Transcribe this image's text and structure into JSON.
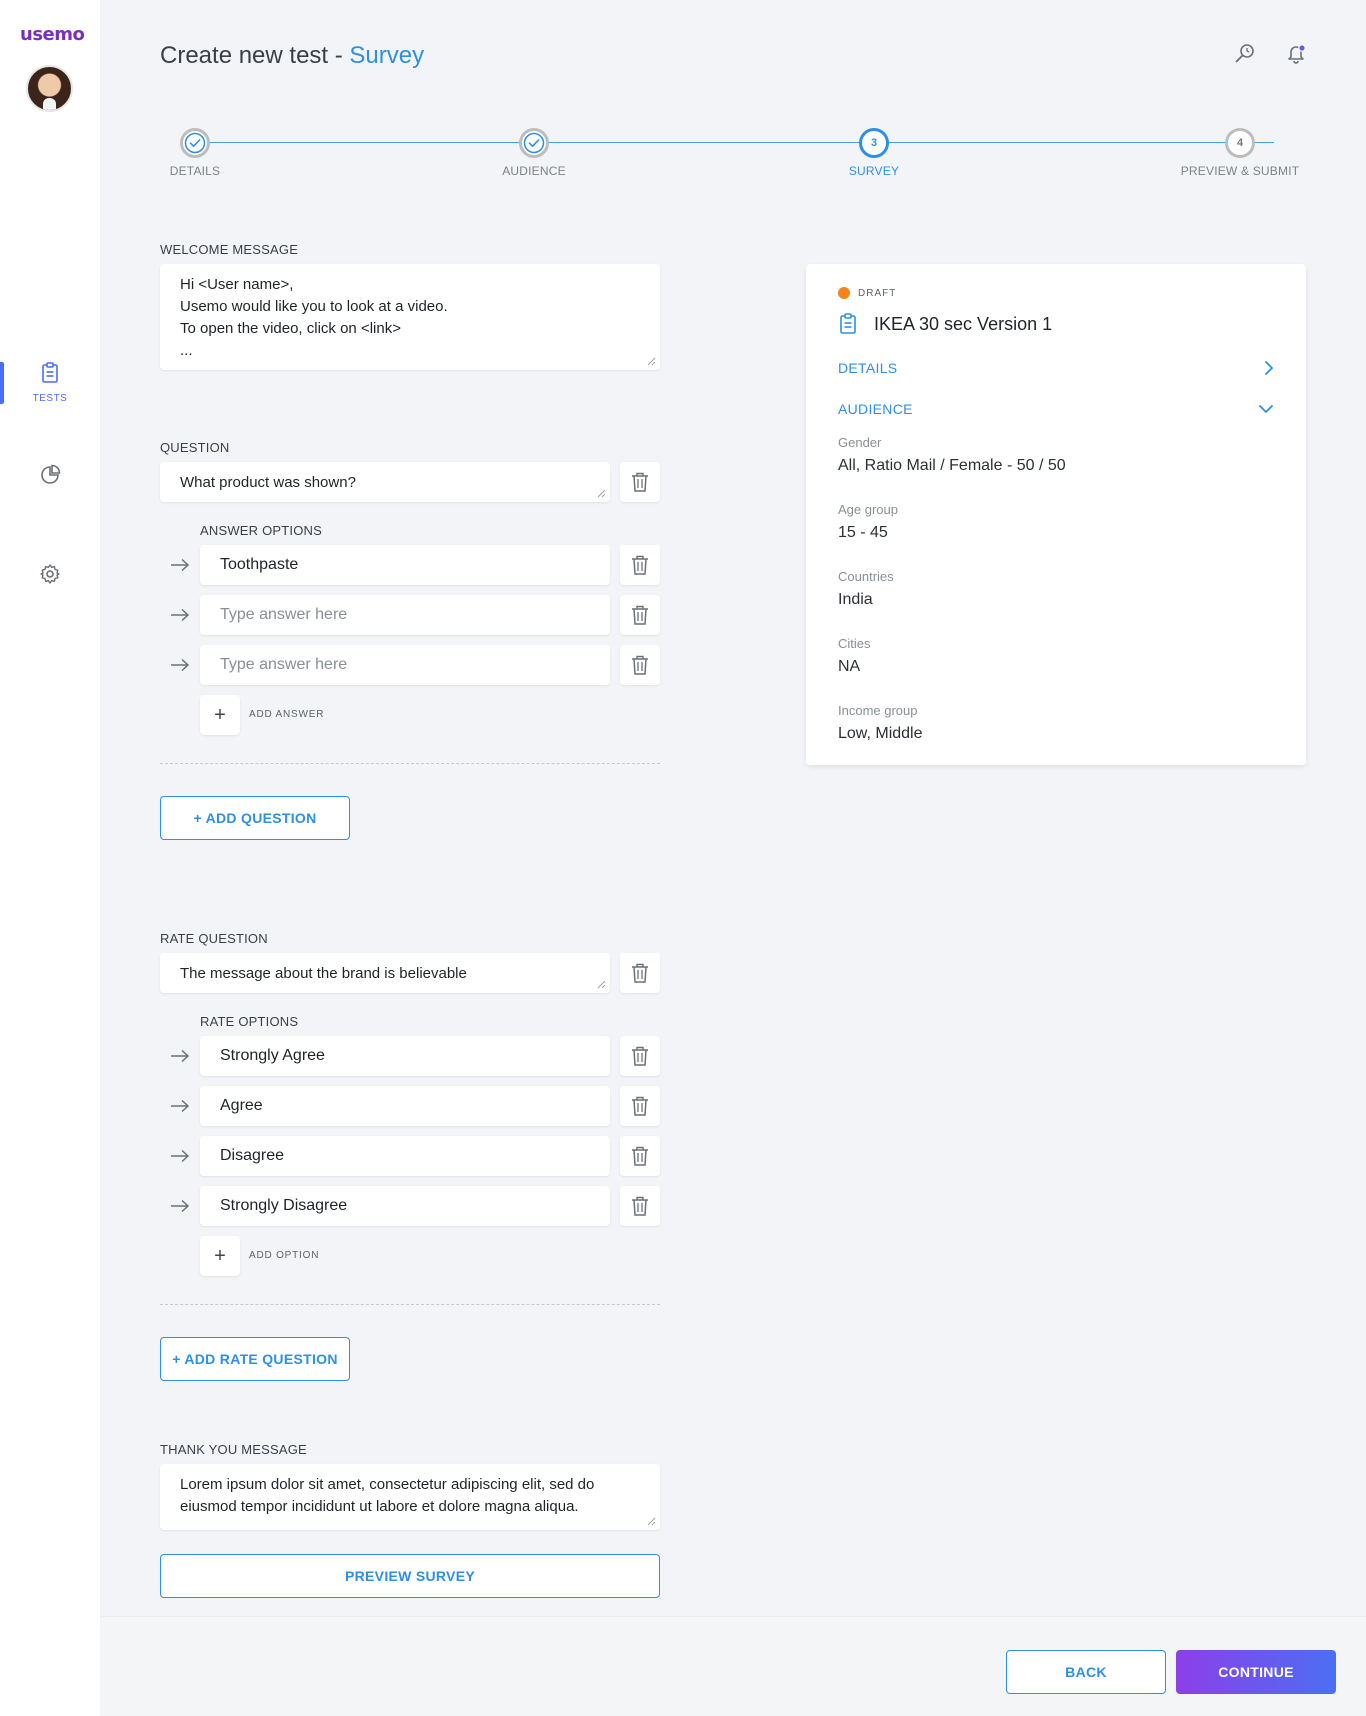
{
  "app": {
    "logo": "usemo"
  },
  "sidebar": {
    "items": [
      {
        "label": "TESTS",
        "icon": "clipboard-icon",
        "active": true
      },
      {
        "label": "",
        "icon": "pie-chart-icon"
      },
      {
        "label": "",
        "icon": "gear-icon"
      }
    ]
  },
  "header": {
    "title_prefix": "Create new test - ",
    "title_accent": "Survey",
    "icons": [
      "search-icon",
      "bell-icon"
    ]
  },
  "stepper": {
    "steps": [
      {
        "number": "1",
        "label": "DETAILS",
        "state": "done"
      },
      {
        "number": "2",
        "label": "AUDIENCE",
        "state": "done"
      },
      {
        "number": "3",
        "label": "SURVEY",
        "state": "active"
      },
      {
        "number": "4",
        "label": "PREVIEW & SUBMIT",
        "state": "todo"
      }
    ]
  },
  "welcome": {
    "label": "WELCOME MESSAGE",
    "lines": [
      "Hi <User name>,",
      "Usemo would like you to look at a video.",
      "To open the video, click on <link>",
      "..."
    ]
  },
  "question": {
    "label": "QUESTION",
    "value": "What product was shown?",
    "answers_label": "ANSWER OPTIONS",
    "answers": [
      {
        "value": "Toothpaste",
        "placeholder": ""
      },
      {
        "value": "",
        "placeholder": "Type answer here"
      },
      {
        "value": "",
        "placeholder": "Type answer here"
      }
    ],
    "add_answer": "ADD ANSWER",
    "add_question": "+ ADD QUESTION"
  },
  "rate_question": {
    "label": "RATE QUESTION",
    "value": "The message about the brand is believable",
    "options_label": "RATE OPTIONS",
    "options": [
      "Strongly Agree",
      "Agree",
      "Disagree",
      "Strongly Disagree"
    ],
    "add_option": "ADD OPTION",
    "add_rate_question": "+ ADD RATE QUESTION"
  },
  "thank_you": {
    "label": "THANK YOU MESSAGE",
    "lines": [
      "Lorem ipsum dolor sit amet, consectetur adipiscing elit, sed do",
      "eiusmod tempor incididunt ut labore et dolore magna aliqua."
    ]
  },
  "preview_button": "PREVIEW SURVEY",
  "card": {
    "status": "DRAFT",
    "status_color": "#f5841f",
    "title": "IKEA 30 sec Version 1",
    "details_link": "DETAILS",
    "audience_link": "AUDIENCE",
    "fields": [
      {
        "label": "Gender",
        "value": "All, Ratio Mail / Female - 50 / 50"
      },
      {
        "label": "Age group",
        "value": "15 - 45"
      },
      {
        "label": "Countries",
        "value": "India"
      },
      {
        "label": "Cities",
        "value": "NA"
      },
      {
        "label": "Income group",
        "value": "Low, Middle"
      }
    ]
  },
  "footer": {
    "back": "BACK",
    "continue": "CONTINUE"
  },
  "colors": {
    "accent": "#2d8fe6",
    "brand": "#7b2fbf",
    "gradient_start": "#8d3fe8",
    "gradient_end": "#4b6ff3"
  }
}
